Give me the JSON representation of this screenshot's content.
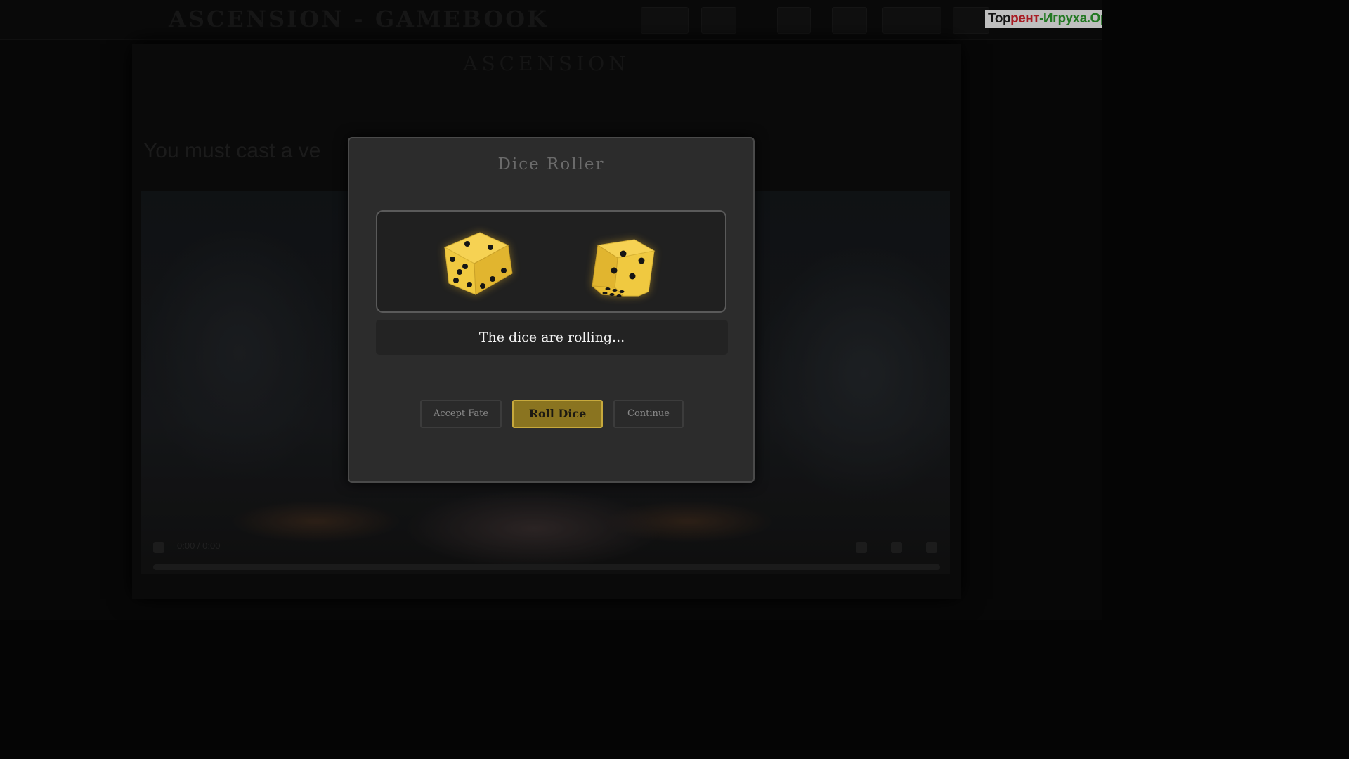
{
  "header": {
    "title": "ASCENSION - GAMEBOOK"
  },
  "watermark": {
    "part1": "Тор",
    "part2": "рент",
    "part3": "-Игруха.Орг"
  },
  "content": {
    "heading": "ASCENSION",
    "story_text": "You must cast a ve",
    "player_time": "0:00 / 0:00"
  },
  "modal": {
    "title": "Dice Roller",
    "status": "The dice are rolling...",
    "dice": [
      {
        "visible_faces": [
          5,
          3,
          2
        ]
      },
      {
        "visible_faces": [
          4,
          6
        ]
      }
    ],
    "buttons": {
      "accept_fate": "Accept Fate",
      "roll_dice": "Roll Dice",
      "continue": "Continue"
    }
  },
  "colors": {
    "accent_gold": "#c7a93c",
    "primary_button_bg": "#8a7420",
    "die_face": "#f0c940",
    "modal_bg": "#2c2c2c"
  }
}
